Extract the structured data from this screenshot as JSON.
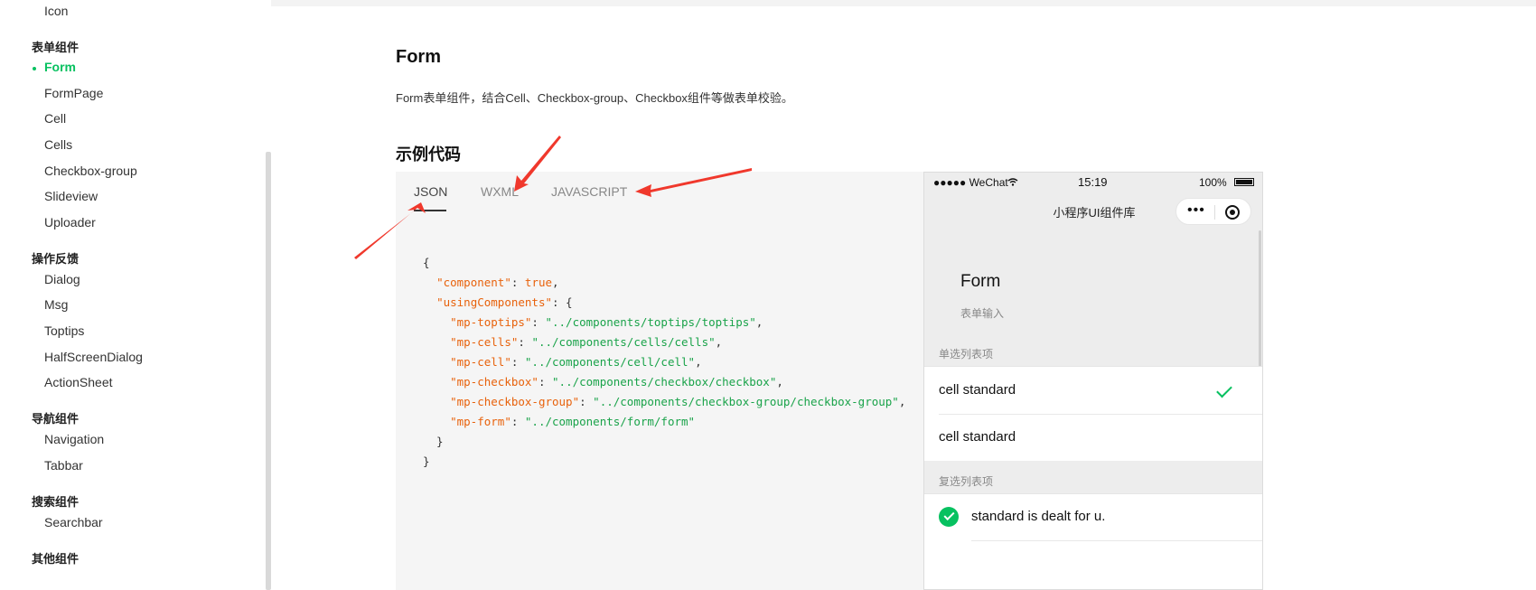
{
  "sidebar": {
    "items": [
      {
        "label": "Icon",
        "type": "item"
      },
      {
        "label": "表单组件",
        "type": "group"
      },
      {
        "label": "Form",
        "type": "item",
        "active": true
      },
      {
        "label": "FormPage",
        "type": "item"
      },
      {
        "label": "Cell",
        "type": "item"
      },
      {
        "label": "Cells",
        "type": "item"
      },
      {
        "label": "Checkbox-group",
        "type": "item"
      },
      {
        "label": "Slideview",
        "type": "item"
      },
      {
        "label": "Uploader",
        "type": "item"
      },
      {
        "label": "操作反馈",
        "type": "group"
      },
      {
        "label": "Dialog",
        "type": "item"
      },
      {
        "label": "Msg",
        "type": "item"
      },
      {
        "label": "Toptips",
        "type": "item"
      },
      {
        "label": "HalfScreenDialog",
        "type": "item"
      },
      {
        "label": "ActionSheet",
        "type": "item"
      },
      {
        "label": "导航组件",
        "type": "group"
      },
      {
        "label": "Navigation",
        "type": "item"
      },
      {
        "label": "Tabbar",
        "type": "item"
      },
      {
        "label": "搜索组件",
        "type": "group"
      },
      {
        "label": "Searchbar",
        "type": "item"
      },
      {
        "label": "其他组件",
        "type": "group"
      }
    ]
  },
  "main": {
    "title": "Form",
    "description": "Form表单组件，结合Cell、Checkbox-group、Checkbox组件等做表单校验。",
    "example_heading": "示例代码",
    "tabs": [
      {
        "label": "JSON",
        "active": true
      },
      {
        "label": "WXML",
        "active": false
      },
      {
        "label": "JAVASCRIPT",
        "active": false
      }
    ],
    "code": {
      "component_key": "\"component\"",
      "component_value": "true",
      "using_key": "\"usingComponents\"",
      "entries": [
        {
          "key": "\"mp-toptips\"",
          "value": "\"../components/toptips/toptips\""
        },
        {
          "key": "\"mp-cells\"",
          "value": "\"../components/cells/cells\""
        },
        {
          "key": "\"mp-cell\"",
          "value": "\"../components/cell/cell\""
        },
        {
          "key": "\"mp-checkbox\"",
          "value": "\"../components/checkbox/checkbox\""
        },
        {
          "key": "\"mp-checkbox-group\"",
          "value": "\"../components/checkbox-group/checkbox-group\""
        },
        {
          "key": "\"mp-form\"",
          "value": "\"../components/form/form\""
        }
      ]
    }
  },
  "phone": {
    "carrier": "●●●●● WeChat",
    "time": "15:19",
    "battery": "100%",
    "nav_title": "小程序UI组件库",
    "capsule_more": "•••",
    "page_title": "Form",
    "page_subtitle": "表单输入",
    "radio_section": "单选列表项",
    "radio_items": [
      "cell standard",
      "cell standard"
    ],
    "checkbox_section": "复选列表项",
    "checkbox_item": "standard is dealt for u."
  },
  "colors": {
    "accent": "#07c160",
    "arrow": "#f0382c",
    "json_key": "#e8620c",
    "json_string": "#1aa34a"
  },
  "icons": [
    "wifi-icon",
    "battery-icon",
    "more-icon",
    "target-icon",
    "check-icon",
    "checkbox-checked-icon",
    "annotation-arrow"
  ]
}
